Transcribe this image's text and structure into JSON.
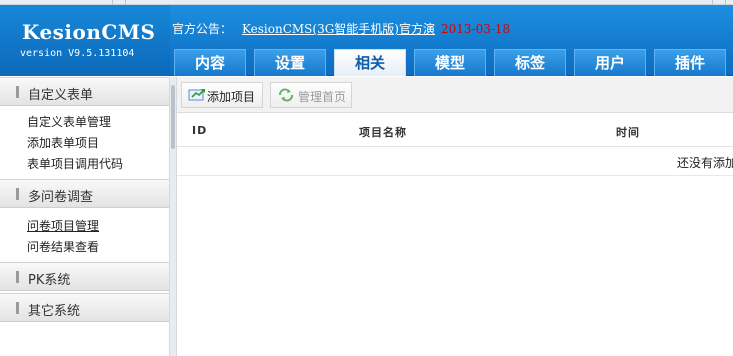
{
  "app": {
    "logo_name": "KesionCMS",
    "logo_version": "version V9.5.131104"
  },
  "notice": {
    "label": "官方公告：",
    "link_text": "KesionCMS(3G智能手机版)官方演",
    "date": "2013-03-18"
  },
  "nav": {
    "tabs": [
      {
        "label": "内容"
      },
      {
        "label": "设置"
      },
      {
        "label": "相关",
        "active": true
      },
      {
        "label": "模型"
      },
      {
        "label": "标签"
      },
      {
        "label": "用户"
      },
      {
        "label": "插件"
      }
    ]
  },
  "sidebar": {
    "sections": [
      {
        "title": "自定义表单",
        "items": [
          "自定义表单管理",
          "添加表单项目",
          "表单项目调用代码"
        ]
      },
      {
        "title": "多问卷调查",
        "items": [
          "问卷项目管理",
          "问卷结果查看"
        ]
      },
      {
        "title": "PK系统",
        "items": []
      },
      {
        "title": "其它系统",
        "items": []
      }
    ]
  },
  "toolbar": {
    "add_label": "添加项目",
    "home_label": "管理首页"
  },
  "table": {
    "columns": [
      "ID",
      "项目名称",
      "时间"
    ],
    "empty_message": "还没有添加"
  },
  "colors": {
    "header_blue": "#0c6cc0",
    "date_red": "#d40000",
    "active_tab_text": "#0c5ea8"
  }
}
